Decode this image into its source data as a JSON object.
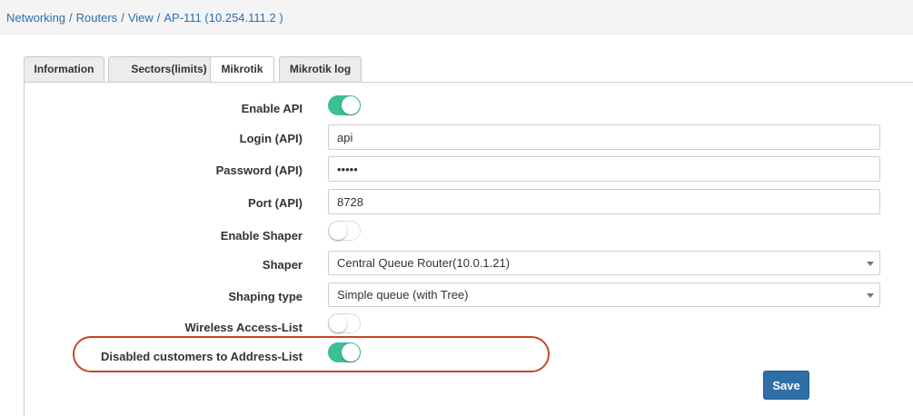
{
  "breadcrumb": {
    "items": [
      "Networking",
      "Routers",
      "View",
      "AP-111 (10.254.111.2 )"
    ],
    "separator": "/"
  },
  "tabs": [
    {
      "label": "Information",
      "active": false
    },
    {
      "label": "Sectors(limits)",
      "active": false
    },
    {
      "label": "Mikrotik",
      "active": true
    },
    {
      "label": "Mikrotik log",
      "active": false
    }
  ],
  "form": {
    "enable_api": {
      "label": "Enable API",
      "on": true
    },
    "login": {
      "label": "Login (API)",
      "value": "api"
    },
    "password": {
      "label": "Password (API)",
      "value": "•••••"
    },
    "port": {
      "label": "Port (API)",
      "value": "8728"
    },
    "enable_shaper": {
      "label": "Enable Shaper",
      "on": false
    },
    "shaper": {
      "label": "Shaper",
      "value": "Central Queue Router(10.0.1.21)"
    },
    "shaping_type": {
      "label": "Shaping type",
      "value": "Simple queue (with Tree)"
    },
    "wireless_access_list": {
      "label": "Wireless Access-List",
      "on": false
    },
    "disabled_customers": {
      "label": "Disabled customers to Address-List",
      "on": true
    }
  },
  "save_label": "Save",
  "colors": {
    "toggle_on": "#3cbf97",
    "link": "#2a6fb0",
    "highlight": "#c8462a",
    "save_button": "#2f6fa8"
  }
}
